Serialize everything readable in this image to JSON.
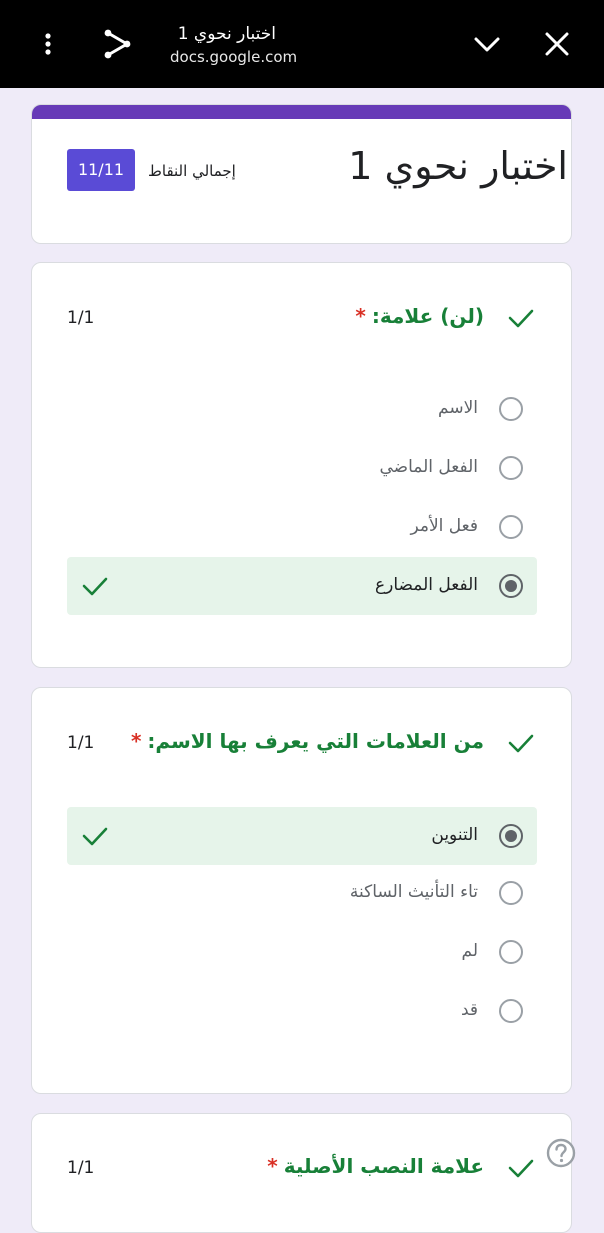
{
  "browser": {
    "page_title": "اختبار نحوي 1",
    "url": "docs.google.com",
    "icons": [
      "more-vert-icon",
      "share-icon",
      "chevron-down-icon",
      "close-icon"
    ]
  },
  "form": {
    "title": "اختبار نحوي 1",
    "total_points_label": "إجمالي النقاط",
    "total_points_value": "11/11",
    "accent_color": "#673ab7"
  },
  "questions": [
    {
      "title": "(لن) علامة:",
      "required_mark": "*",
      "score": "1/1",
      "options": [
        {
          "label": "الاسم",
          "selected": false
        },
        {
          "label": "الفعل الماضي",
          "selected": false
        },
        {
          "label": "فعل الأمر",
          "selected": false
        },
        {
          "label": "الفعل المضارع",
          "selected": true,
          "correct": true
        }
      ]
    },
    {
      "title": "من العلامات التي يعرف بها الاسم:",
      "required_mark": "*",
      "score": "1/1",
      "options": [
        {
          "label": "التنوين",
          "selected": true,
          "correct": true
        },
        {
          "label": "تاء التأنيث الساكنة",
          "selected": false
        },
        {
          "label": "لم",
          "selected": false
        },
        {
          "label": "قد",
          "selected": false
        }
      ]
    },
    {
      "title": "علامة النصب الأصلية",
      "required_mark": "*",
      "score": "1/1"
    }
  ],
  "colors": {
    "correct_green": "#188038",
    "required_red": "#d93025",
    "badge_purple": "#5a4bd6",
    "correct_bg": "#e6f4ea"
  }
}
